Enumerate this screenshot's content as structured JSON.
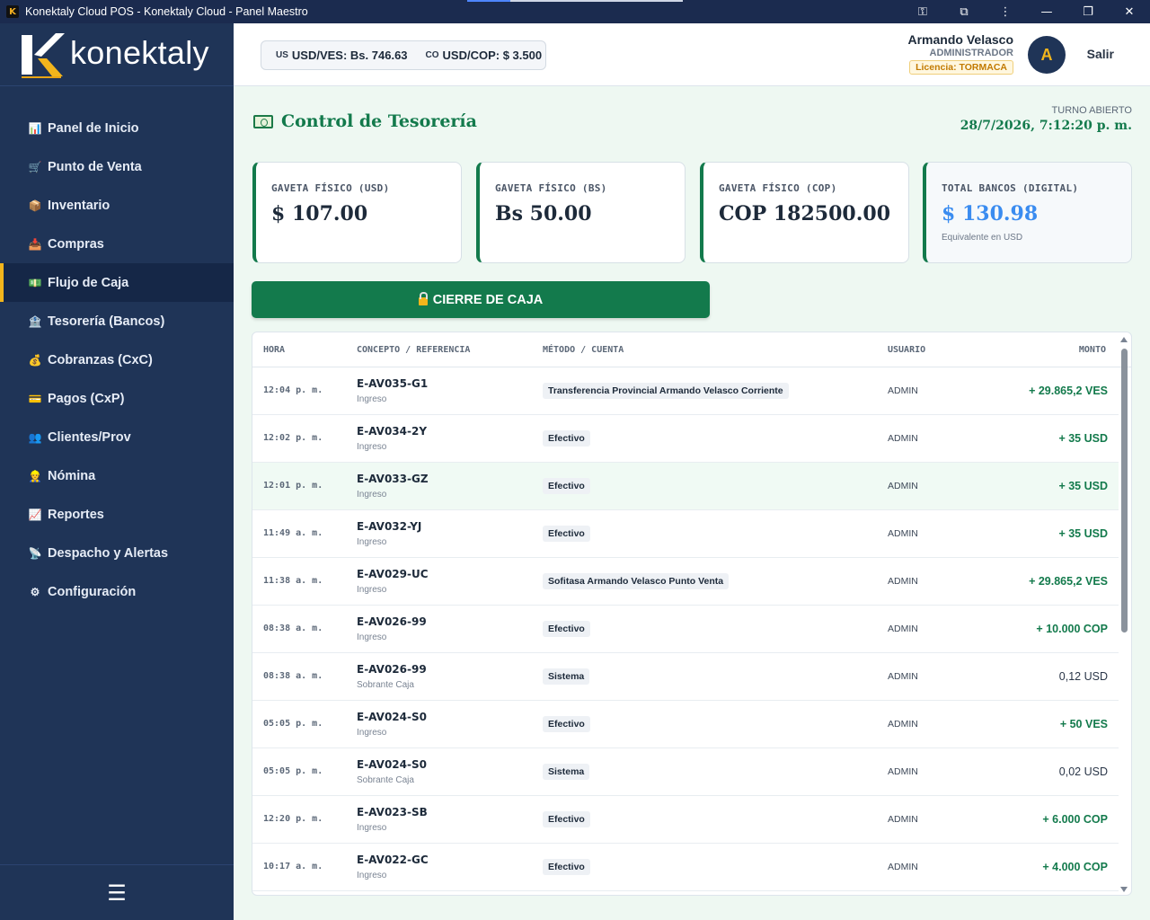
{
  "window": {
    "title": "Konektaly Cloud POS - Konektaly Cloud - Panel Maestro",
    "logo_text": "konektaly"
  },
  "sidebar": {
    "items": [
      {
        "label": "Panel de Inicio",
        "icon": "chart-icon",
        "glyph": "📊"
      },
      {
        "label": "Punto de Venta",
        "icon": "cart-icon",
        "glyph": "🛒"
      },
      {
        "label": "Inventario",
        "icon": "box-icon",
        "glyph": "📦"
      },
      {
        "label": "Compras",
        "icon": "download-icon",
        "glyph": "📥"
      },
      {
        "label": "Flujo de Caja",
        "icon": "money-icon",
        "glyph": "💵",
        "active": true
      },
      {
        "label": "Tesorería (Bancos)",
        "icon": "bank-icon",
        "glyph": "🏦"
      },
      {
        "label": "Cobranzas (CxC)",
        "icon": "moneybag-icon",
        "glyph": "💰"
      },
      {
        "label": "Pagos (CxP)",
        "icon": "card-icon",
        "glyph": "💳"
      },
      {
        "label": "Clientes/Prov",
        "icon": "users-icon",
        "glyph": "👥"
      },
      {
        "label": "Nómina",
        "icon": "worker-icon",
        "glyph": "👷"
      },
      {
        "label": "Reportes",
        "icon": "report-icon",
        "glyph": "📈"
      },
      {
        "label": "Despacho y Alertas",
        "icon": "satellite-icon",
        "glyph": "📡"
      },
      {
        "label": "Configuración",
        "icon": "gear-icon",
        "glyph": "⚙"
      }
    ],
    "menu_glyph": "☰"
  },
  "header": {
    "rate1_code": "US",
    "rate1_text": "USD/VES: Bs. 746.63",
    "rate2_code": "CO",
    "rate2_text": "USD/COP: $ 3.500",
    "user_name": "Armando Velasco",
    "user_role": "ADMINISTRADOR",
    "license": "Licencia: TORMACA",
    "avatar_letter": "A",
    "logout": "Salir"
  },
  "main": {
    "title": "Control de Tesorería",
    "shift_label": "TURNO ABIERTO",
    "shift_date": "28/7/2026, 7:12:20 p. m.",
    "close_button": "CIERRE DE CAJA"
  },
  "cards": [
    {
      "label": "GAVETA FÍSICO (USD)",
      "value": "$ 107.00"
    },
    {
      "label": "GAVETA FÍSICO (BS)",
      "value": "Bs 50.00"
    },
    {
      "label": "GAVETA FÍSICO (COP)",
      "value": "COP 182500.00"
    },
    {
      "label": "TOTAL BANCOS (DIGITAL)",
      "value": "$ 130.98",
      "sub": "Equivalente en USD"
    }
  ],
  "table": {
    "headers": {
      "time": "HORA",
      "concept": "CONCEPTO / REFERENCIA",
      "method": "MÉTODO / CUENTA",
      "user": "USUARIO",
      "amount": "MONTO"
    },
    "rows": [
      {
        "time": "12:04 p. m.",
        "ref": "E-AV035-G1",
        "type": "Ingreso",
        "method": "Transferencia Provincial Armando Velasco Corriente",
        "user": "ADMIN",
        "amount": "+ 29.865,2 VES"
      },
      {
        "time": "12:02 p. m.",
        "ref": "E-AV034-2Y",
        "type": "Ingreso",
        "method": "Efectivo",
        "user": "ADMIN",
        "amount": "+ 35 USD"
      },
      {
        "time": "12:01 p. m.",
        "ref": "E-AV033-GZ",
        "type": "Ingreso",
        "method": "Efectivo",
        "user": "ADMIN",
        "amount": "+ 35 USD"
      },
      {
        "time": "11:49 a. m.",
        "ref": "E-AV032-YJ",
        "type": "Ingreso",
        "method": "Efectivo",
        "user": "ADMIN",
        "amount": "+ 35 USD"
      },
      {
        "time": "11:38 a. m.",
        "ref": "E-AV029-UC",
        "type": "Ingreso",
        "method": "Sofitasa Armando Velasco Punto Venta",
        "user": "ADMIN",
        "amount": "+ 29.865,2 VES"
      },
      {
        "time": "08:38 a. m.",
        "ref": "E-AV026-99",
        "type": "Ingreso",
        "method": "Efectivo",
        "user": "ADMIN",
        "amount": "+ 10.000 COP"
      },
      {
        "time": "08:38 a. m.",
        "ref": "E-AV026-99",
        "type": "Sobrante Caja",
        "method": "Sistema",
        "user": "ADMIN",
        "amount": "0,12 USD"
      },
      {
        "time": "05:05 p. m.",
        "ref": "E-AV024-S0",
        "type": "Ingreso",
        "method": "Efectivo",
        "user": "ADMIN",
        "amount": "+ 50 VES"
      },
      {
        "time": "05:05 p. m.",
        "ref": "E-AV024-S0",
        "type": "Sobrante Caja",
        "method": "Sistema",
        "user": "ADMIN",
        "amount": "0,02 USD"
      },
      {
        "time": "12:20 p. m.",
        "ref": "E-AV023-SB",
        "type": "Ingreso",
        "method": "Efectivo",
        "user": "ADMIN",
        "amount": "+ 6.000 COP"
      },
      {
        "time": "10:17 a. m.",
        "ref": "E-AV022-GC",
        "type": "Ingreso",
        "method": "Efectivo",
        "user": "ADMIN",
        "amount": "+ 4.000 COP"
      }
    ]
  }
}
